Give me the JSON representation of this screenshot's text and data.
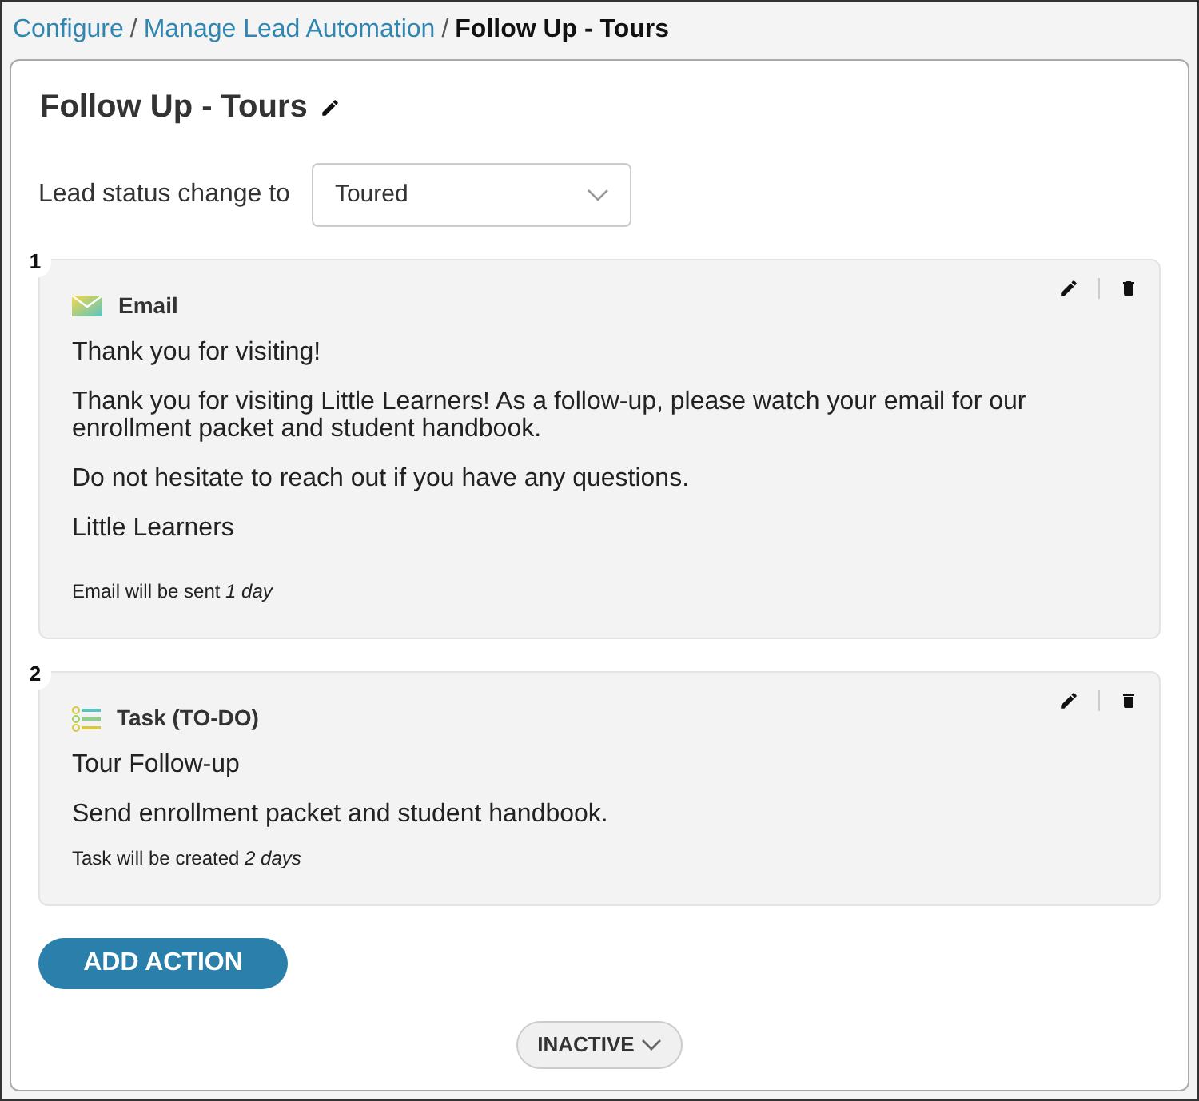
{
  "breadcrumb": [
    {
      "label": "Configure",
      "kind": "link"
    },
    {
      "separator": "/",
      "label": "Manage Lead Automation",
      "kind": "link"
    },
    {
      "separator": "/",
      "label": "Follow Up - Tours",
      "kind": "current"
    }
  ],
  "title": "Follow Up - Tours",
  "status_change": {
    "label": "Lead status change to",
    "value": "Toured"
  },
  "actions": [
    {
      "number": "1",
      "kind": "email",
      "type_label": "Email",
      "lines": [
        "Thank you for visiting!",
        "Thank you for visiting Little Learners! As a follow-up, please watch your email for our enrollment packet and student handbook.",
        "Do not hesitate to reach out if you have any questions.",
        "Little Learners"
      ],
      "footer": "Email will be sent *1 day*"
    },
    {
      "number": "2",
      "kind": "task",
      "type_label": "Task (TO-DO)",
      "lines": [
        "Tour Follow-up",
        "Send enrollment packet and student handbook."
      ],
      "footer": "Task will be created *2 days*"
    }
  ],
  "add_button": "ADD ACTION",
  "status_button": "INACTIVE"
}
